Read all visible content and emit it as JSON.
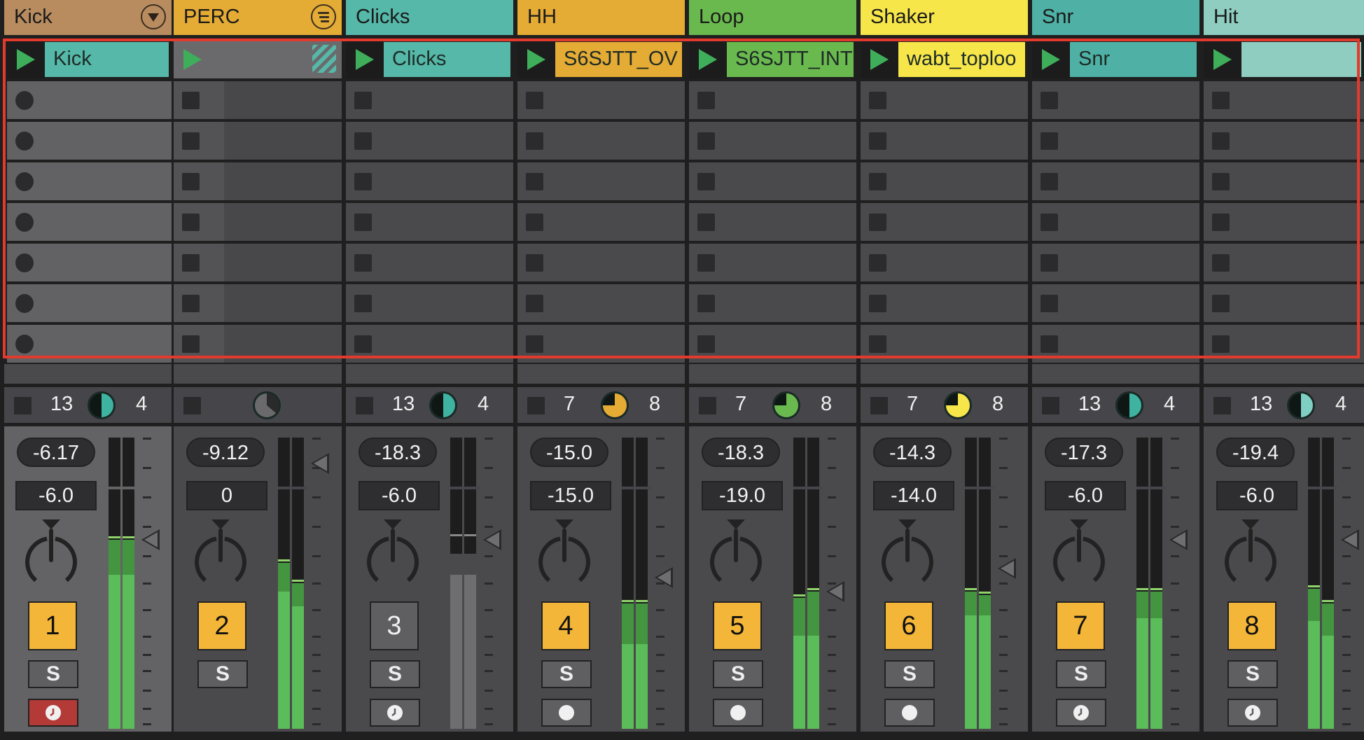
{
  "app": "Ableton Live Session View",
  "tracks": [
    {
      "name": "Kick",
      "color": "#b98c5f",
      "header_icon": "fold-triangle-icon",
      "selected": true,
      "group": false,
      "clip": {
        "name": "Kick",
        "color": "#55b8a8",
        "playing": true
      },
      "empty_slot_style": "record",
      "input_left": "13",
      "input_right": "4",
      "pie_color": "#3fb3a1",
      "pie_fraction": 0.5,
      "volume_readout": "-6.17",
      "send_value": "-6.0",
      "track_number": "1",
      "track_active": true,
      "solo": "S",
      "arm_icon": "clock-icon",
      "arm_red": true,
      "meter": {
        "left": 0.65,
        "right": 0.65,
        "left_bright": 0.53,
        "right_bright": 0.53,
        "fader": 0.65
      }
    },
    {
      "name": "PERC",
      "color": "#e4ab35",
      "header_icon": "group-list-icon",
      "selected": false,
      "group": true,
      "clip": {
        "name": "",
        "color": "#6a6a6c",
        "playing": true,
        "hatched": true
      },
      "empty_slot_style": "stop",
      "input_left": "",
      "input_right": "",
      "pie_color": "#6a6a6c",
      "pie_fraction": 0.65,
      "volume_readout": "-9.12",
      "send_value": "0",
      "track_number": "2",
      "track_active": true,
      "solo": "S",
      "arm_icon": "",
      "arm_red": false,
      "meter": {
        "left": 0.57,
        "right": 0.5,
        "left_bright": 0.47,
        "right_bright": 0.42,
        "fader": 0.91
      }
    },
    {
      "name": "Clicks",
      "color": "#55b8a8",
      "header_icon": "",
      "selected": false,
      "group": false,
      "clip": {
        "name": "Clicks",
        "color": "#55b8a8",
        "playing": true
      },
      "empty_slot_style": "stop",
      "input_left": "13",
      "input_right": "4",
      "pie_color": "#3fb3a1",
      "pie_fraction": 0.5,
      "volume_readout": "-18.3",
      "send_value": "-6.0",
      "track_number": "3",
      "track_active": false,
      "solo": "S",
      "arm_icon": "clock-icon",
      "arm_red": false,
      "meter": {
        "left": 0.0,
        "right": 0.0,
        "left_bright": 0,
        "right_bright": 0,
        "fader": 0.65,
        "inactive": true
      }
    },
    {
      "name": "HH",
      "color": "#e4ab35",
      "header_icon": "",
      "selected": false,
      "group": false,
      "clip": {
        "name": "S6SJTT_OV",
        "color": "#e4ab35",
        "playing": true
      },
      "empty_slot_style": "stop",
      "input_left": "7",
      "input_right": "8",
      "pie_color": "#e4ab35",
      "pie_fraction": 0.75,
      "volume_readout": "-15.0",
      "send_value": "-15.0",
      "track_number": "4",
      "track_active": true,
      "solo": "S",
      "arm_icon": "record-dot-icon",
      "arm_red": false,
      "meter": {
        "left": 0.43,
        "right": 0.43,
        "left_bright": 0.29,
        "right_bright": 0.29,
        "fader": 0.52
      }
    },
    {
      "name": "Loop",
      "color": "#6ab94f",
      "header_icon": "",
      "selected": false,
      "group": false,
      "clip": {
        "name": "S6SJTT_INT",
        "color": "#6ab94f",
        "playing": true
      },
      "empty_slot_style": "stop",
      "input_left": "7",
      "input_right": "8",
      "pie_color": "#6ab94f",
      "pie_fraction": 0.75,
      "volume_readout": "-18.3",
      "send_value": "-19.0",
      "track_number": "5",
      "track_active": true,
      "solo": "S",
      "arm_icon": "record-dot-icon",
      "arm_red": false,
      "meter": {
        "left": 0.45,
        "right": 0.47,
        "left_bright": 0.32,
        "right_bright": 0.32,
        "fader": 0.47
      }
    },
    {
      "name": "Shaker",
      "color": "#f6e64a",
      "header_icon": "",
      "selected": false,
      "group": false,
      "clip": {
        "name": "wabt_toploo",
        "color": "#f6e64a",
        "playing": true
      },
      "empty_slot_style": "stop",
      "input_left": "7",
      "input_right": "8",
      "pie_color": "#f6e64a",
      "pie_fraction": 0.75,
      "volume_readout": "-14.3",
      "send_value": "-14.0",
      "track_number": "6",
      "track_active": true,
      "solo": "S",
      "arm_icon": "record-dot-icon",
      "arm_red": false,
      "meter": {
        "left": 0.47,
        "right": 0.46,
        "left_bright": 0.39,
        "right_bright": 0.39,
        "fader": 0.55
      }
    },
    {
      "name": "Snr",
      "color": "#4fb1a5",
      "header_icon": "",
      "selected": false,
      "group": false,
      "clip": {
        "name": "Snr",
        "color": "#4fb1a5",
        "playing": true
      },
      "empty_slot_style": "stop",
      "input_left": "13",
      "input_right": "4",
      "pie_color": "#3fb3a1",
      "pie_fraction": 0.5,
      "volume_readout": "-17.3",
      "send_value": "-6.0",
      "track_number": "7",
      "track_active": true,
      "solo": "S",
      "arm_icon": "clock-icon",
      "arm_red": false,
      "meter": {
        "left": 0.47,
        "right": 0.47,
        "left_bright": 0.38,
        "right_bright": 0.38,
        "fader": 0.65
      }
    },
    {
      "name": "Hit",
      "color": "#8ecdc0",
      "header_icon": "",
      "selected": false,
      "group": false,
      "clip": {
        "name": "",
        "color": "#8ecdc0",
        "playing": true
      },
      "empty_slot_style": "stop",
      "input_left": "13",
      "input_right": "4",
      "pie_color": "#7fd0c3",
      "pie_fraction": 0.5,
      "volume_readout": "-19.4",
      "send_value": "-6.0",
      "track_number": "8",
      "track_active": true,
      "solo": "S",
      "arm_icon": "clock-icon",
      "arm_red": false,
      "meter": {
        "left": 0.48,
        "right": 0.43,
        "left_bright": 0.37,
        "right_bright": 0.32,
        "fader": 0.65
      }
    }
  ],
  "empty_rows": 7,
  "selection_color": "#e23a2c"
}
